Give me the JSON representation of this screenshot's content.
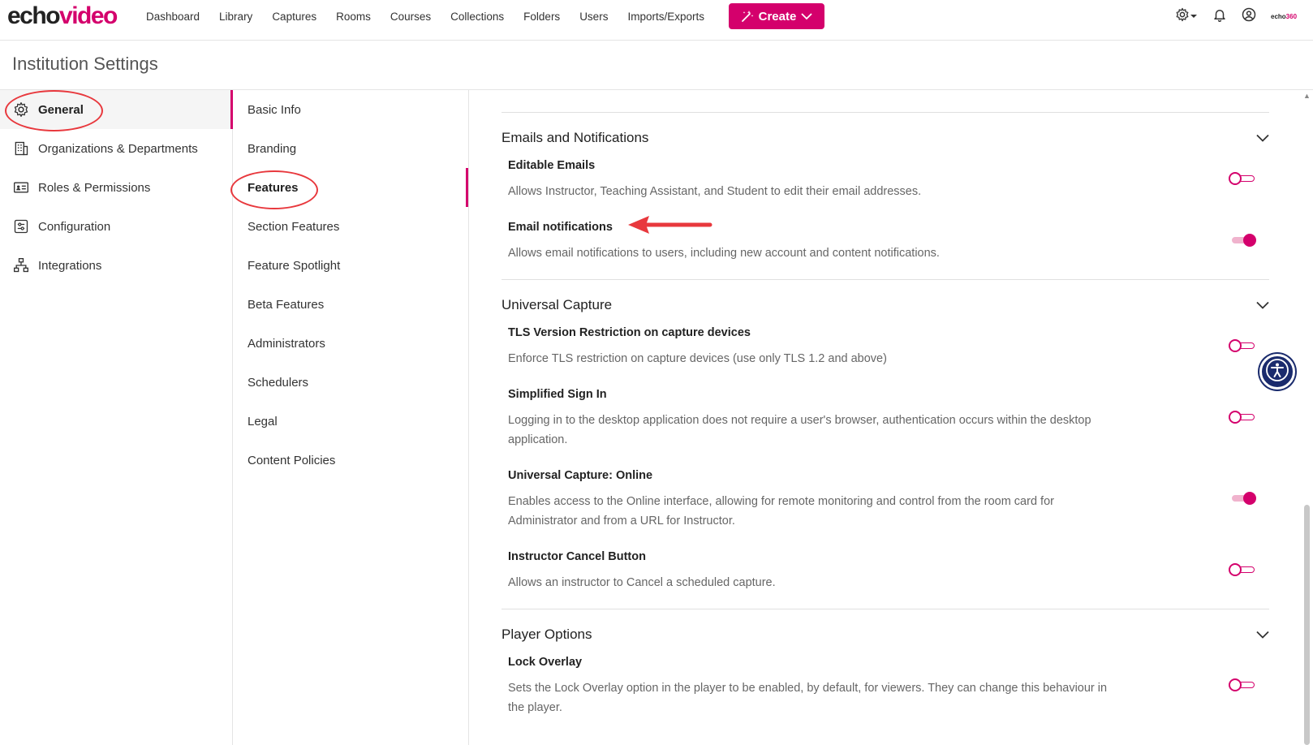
{
  "brand": {
    "logo_part1": "echo",
    "logo_part2": "video",
    "accent": "#d4006c",
    "mini_logo_part1": "echo",
    "mini_logo_part2": "360"
  },
  "nav": {
    "links": [
      "Dashboard",
      "Library",
      "Captures",
      "Rooms",
      "Courses",
      "Collections",
      "Folders",
      "Users",
      "Imports/Exports"
    ],
    "create_label": "Create",
    "icons": [
      "gear-icon",
      "bell-icon",
      "user-circle-icon"
    ]
  },
  "page": {
    "title": "Institution Settings"
  },
  "sidebar": {
    "items": [
      {
        "label": "General",
        "icon": "gear-icon",
        "active": true
      },
      {
        "label": "Organizations & Departments",
        "icon": "building-icon"
      },
      {
        "label": "Roles & Permissions",
        "icon": "id-card-icon"
      },
      {
        "label": "Configuration",
        "icon": "sliders-icon"
      },
      {
        "label": "Integrations",
        "icon": "network-icon"
      }
    ]
  },
  "subnav": {
    "items": [
      "Basic Info",
      "Branding",
      "Features",
      "Section Features",
      "Feature Spotlight",
      "Beta Features",
      "Administrators",
      "Schedulers",
      "Legal",
      "Content Policies"
    ],
    "active": "Features"
  },
  "sections": [
    {
      "title": "Emails and Notifications",
      "settings": [
        {
          "title": "Editable Emails",
          "desc": "Allows Instructor, Teaching Assistant, and Student to edit their email addresses.",
          "enabled": false
        },
        {
          "title": "Email notifications",
          "desc": "Allows email notifications to users, including new account and content notifications.",
          "enabled": true
        }
      ]
    },
    {
      "title": "Universal Capture",
      "settings": [
        {
          "title": "TLS Version Restriction on capture devices",
          "desc": "Enforce TLS restriction on capture devices (use only TLS 1.2 and above)",
          "enabled": false
        },
        {
          "title": "Simplified Sign In",
          "desc": "Logging in to the desktop application does not require a user's browser, authentication occurs within the desktop application.",
          "enabled": false
        },
        {
          "title": "Universal Capture: Online",
          "desc": "Enables access to the Online interface, allowing for remote monitoring and control from the room card for Administrator and from a URL for Instructor.",
          "enabled": true
        },
        {
          "title": "Instructor Cancel Button",
          "desc": "Allows an instructor to Cancel a scheduled capture.",
          "enabled": false
        }
      ]
    },
    {
      "title": "Player Options",
      "settings": [
        {
          "title": "Lock Overlay",
          "desc": "Sets the Lock Overlay option in the player to be enabled, by default, for viewers. They can change this behaviour in the player.",
          "enabled": false
        }
      ]
    }
  ]
}
